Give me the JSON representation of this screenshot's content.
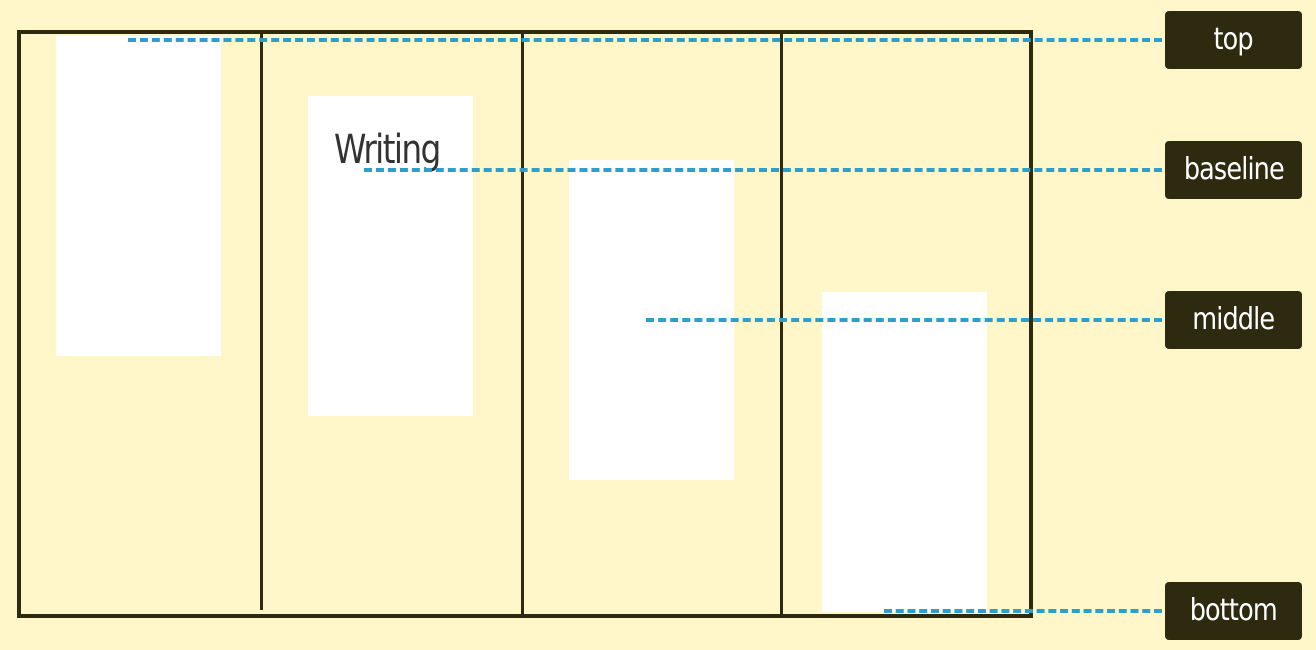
{
  "sample_word": "Writing",
  "labels": {
    "top": "top",
    "baseline": "baseline",
    "middle": "middle",
    "bottom": "bottom"
  },
  "colors": {
    "background": "#fff7c9",
    "frame": "#2e2a10",
    "box": "#ffffff",
    "dashed_line": "#2ba0d0",
    "tag_background": "#2e2a10",
    "tag_text": "#ffffff"
  }
}
